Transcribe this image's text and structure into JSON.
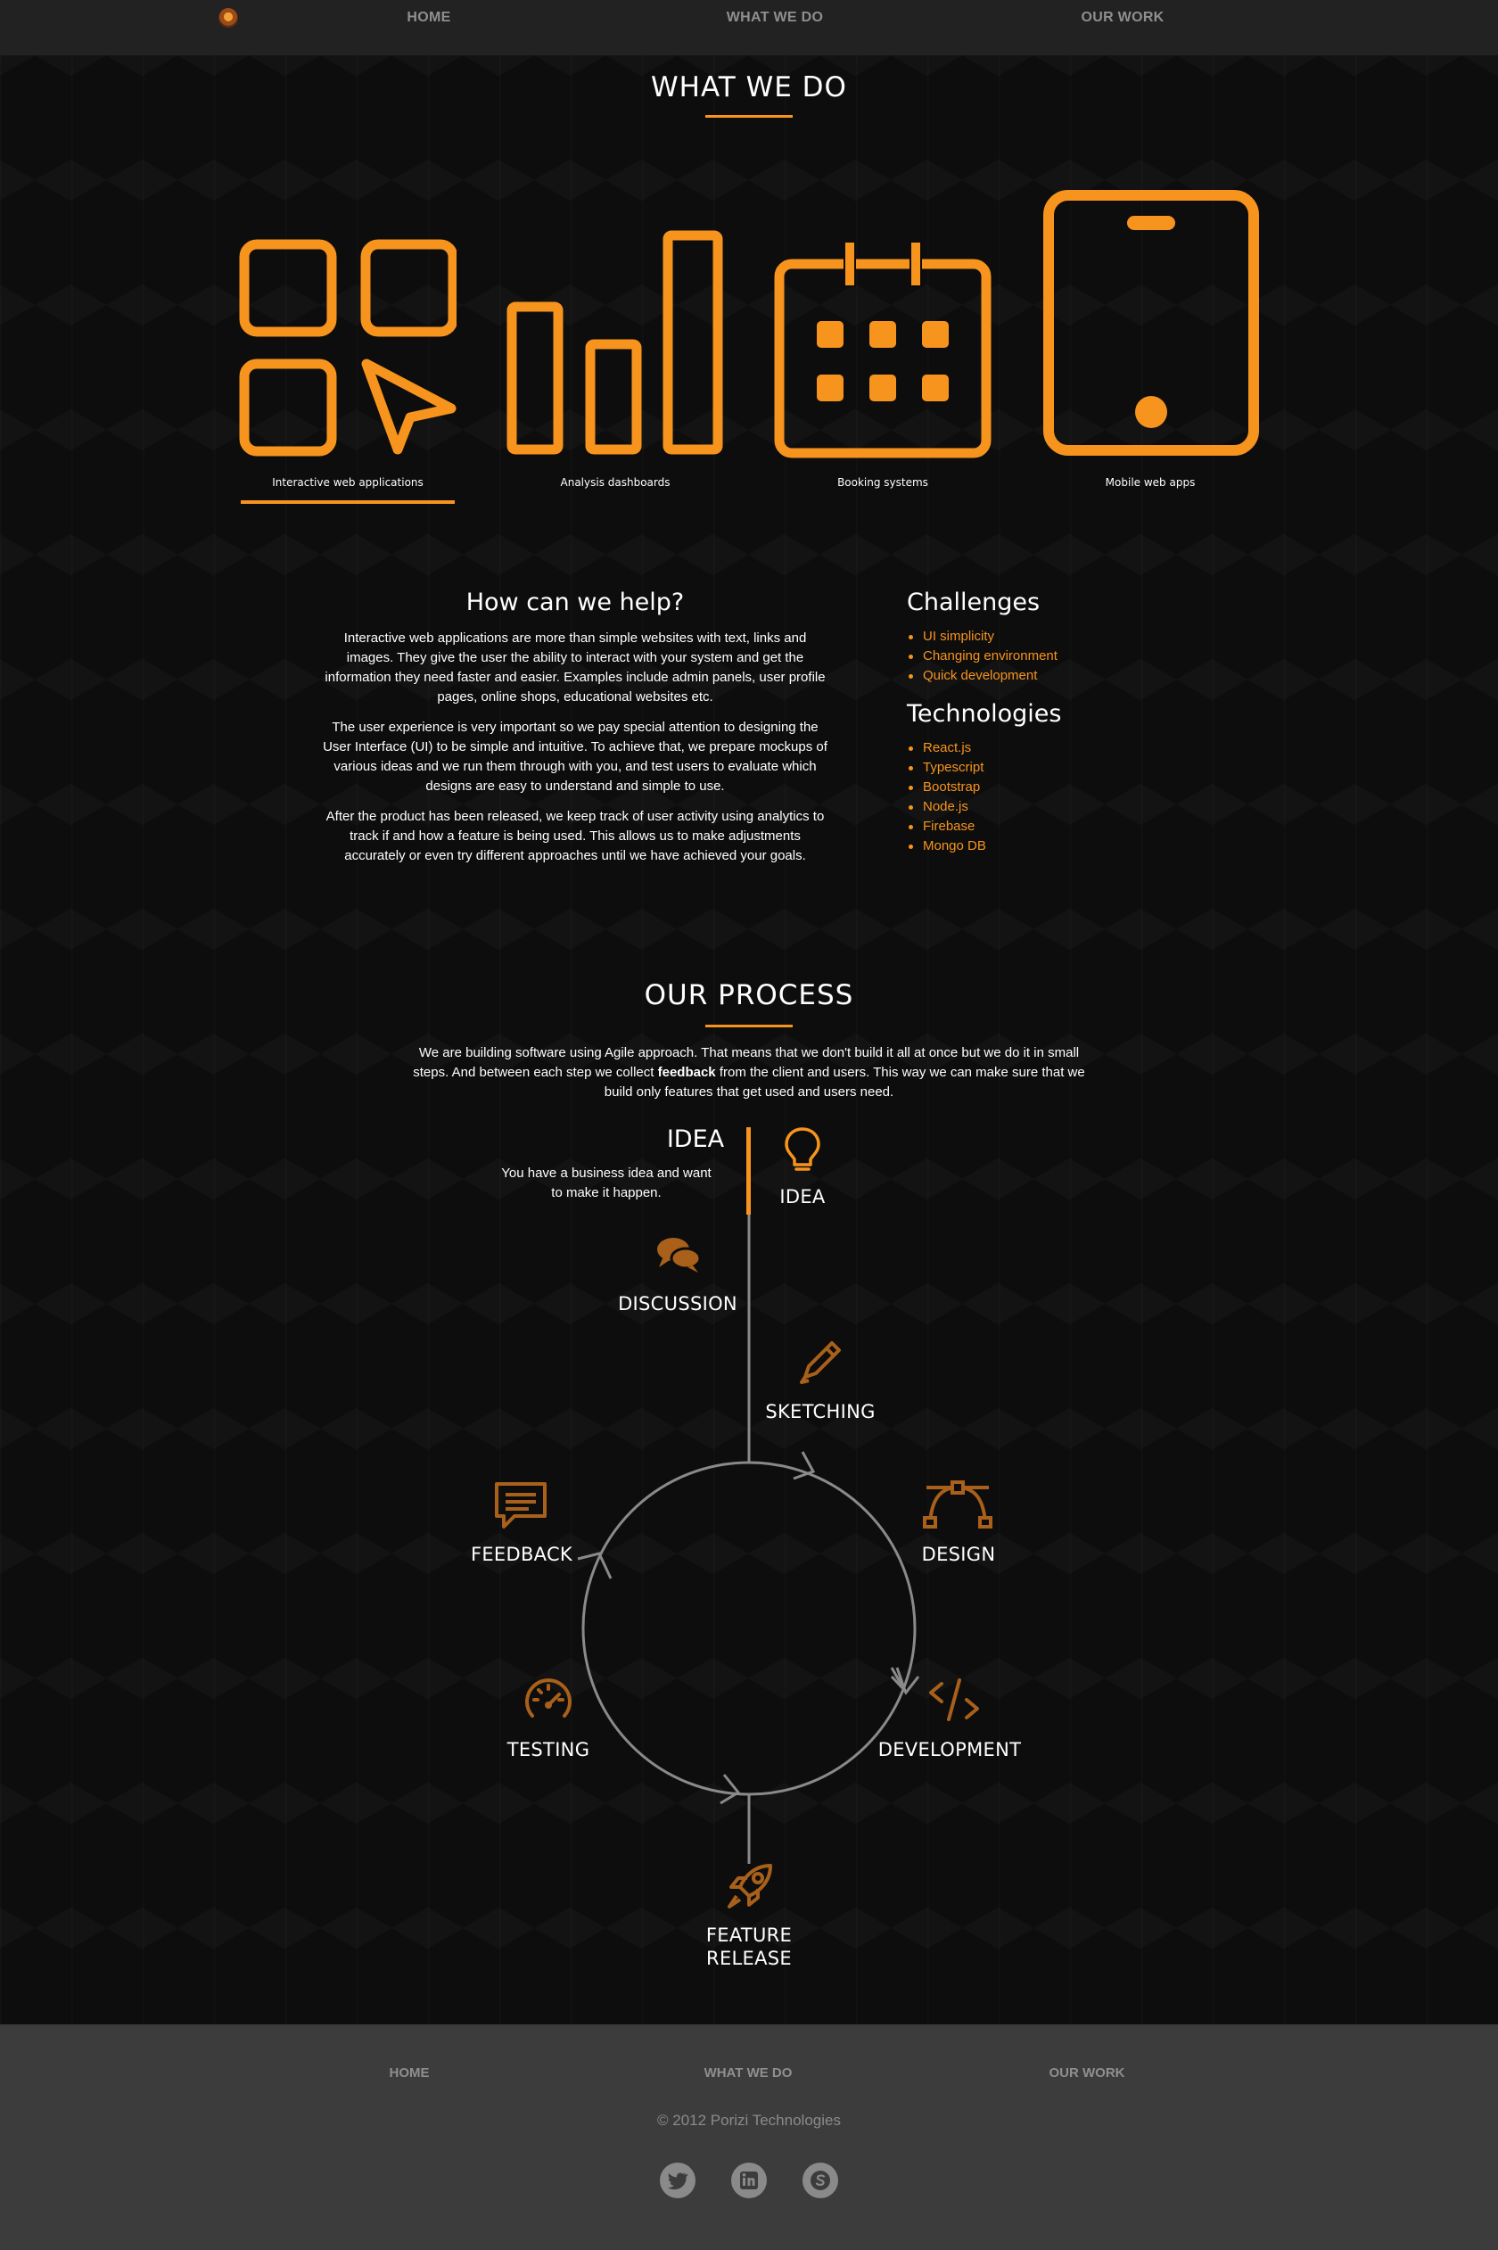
{
  "nav": {
    "items": [
      "HOME",
      "WHAT WE DO",
      "OUR WORK"
    ]
  },
  "what_we_do": {
    "title": "WHAT WE DO",
    "services": [
      {
        "label": "Interactive web applications",
        "icon": "grid-cursor-icon",
        "active": true
      },
      {
        "label": "Analysis dashboards",
        "icon": "bar-chart-icon",
        "active": false
      },
      {
        "label": "Booking systems",
        "icon": "calendar-icon",
        "active": false
      },
      {
        "label": "Mobile web apps",
        "icon": "mobile-icon",
        "active": false
      }
    ]
  },
  "help": {
    "title": "How can we help?",
    "paragraphs": [
      "Interactive web applications are more than simple websites with text, links and images. They give the user the ability to interact with your system and get the information they need faster and easier. Examples include admin panels, user profile pages, online shops, educational websites etc.",
      "The user experience is very important so we pay special attention to designing the User Interface (UI) to be simple and intuitive. To achieve that, we prepare mockups of various ideas and we run them through with you, and test users to evaluate which designs are easy to understand and simple to use.",
      "After the product has been released, we keep track of user activity using analytics to track if and how a feature is being used. This allows us to make adjustments accurately or even try different approaches until we have achieved your goals."
    ],
    "challenges_title": "Challenges",
    "challenges": [
      "UI simplicity",
      "Changing environment",
      "Quick development"
    ],
    "technologies_title": "Technologies",
    "technologies": [
      "React.js",
      "Typescript",
      "Bootstrap",
      "Node.js",
      "Firebase",
      "Mongo DB"
    ]
  },
  "process": {
    "title": "OUR PROCESS",
    "intro_before": "We are building software using Agile approach. That means that we don't build it all at once but we do it in small steps. And between each step we collect ",
    "intro_bold": "feedback",
    "intro_after": " from the client and users. This way we can make sure that we build only features that get used and users need.",
    "active_step_title": "IDEA",
    "active_step_desc": "You have a business idea and want to make it happen.",
    "steps": {
      "idea": "IDEA",
      "discussion": "DISCUSSION",
      "sketching": "SKETCHING",
      "design": "DESIGN",
      "development": "DEVELOPMENT",
      "testing": "TESTING",
      "feedback": "FEEDBACK",
      "feature_release_line1": "FEATURE",
      "feature_release_line2": "RELEASE"
    }
  },
  "footer": {
    "items": [
      "HOME",
      "WHAT WE DO",
      "OUR WORK"
    ],
    "copyright": "© 2012 Porizi Technologies",
    "social": [
      "twitter-icon",
      "linkedin-icon",
      "skype-icon"
    ]
  },
  "colors": {
    "accent": "#f7941d",
    "accent_dim": "#a8601a",
    "nav_bg": "#222222",
    "footer_bg": "#3c3c3c"
  }
}
